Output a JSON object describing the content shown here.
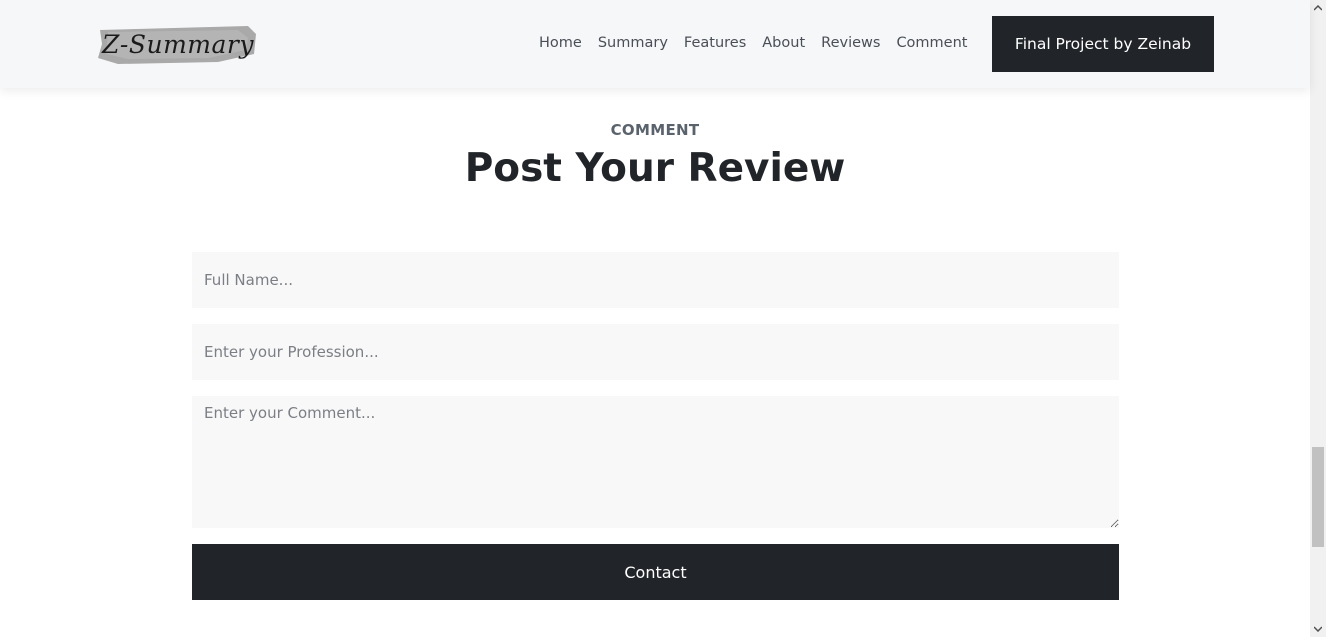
{
  "header": {
    "logo_text": "Z-Summary",
    "nav": [
      "Home",
      "Summary",
      "Features",
      "About",
      "Reviews",
      "Comment"
    ],
    "cta_label": "Final Project by Zeinab"
  },
  "section": {
    "eyebrow": "COMMENT",
    "title": "Post Your Review"
  },
  "form": {
    "name_placeholder": "Full Name...",
    "profession_placeholder": "Enter your Profession...",
    "comment_placeholder": "Enter your Comment...",
    "submit_label": "Contact"
  },
  "icons": {
    "scroll_up": "chevron-up-icon",
    "scroll_down": "chevron-down-icon"
  },
  "colors": {
    "dark": "#212529",
    "field_bg": "#f8f8f8",
    "header_bg": "#f6f7f9"
  }
}
